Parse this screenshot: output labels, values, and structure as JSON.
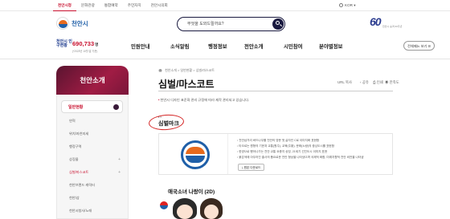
{
  "topbar": {
    "tabs": [
      "천안시청",
      "문화관광",
      "통합예약",
      "주민자치",
      "천안시의회"
    ],
    "active_tab_index": 0,
    "lang": "KOR"
  },
  "header": {
    "logo_text": "천안시",
    "search_placeholder": "무엇을 도와드릴까요?",
    "anniversary_number": "60",
    "anniversary_sub": "천안시 승격 60주년"
  },
  "population": {
    "label": "천안시 인구현황",
    "count": "690,733",
    "unit": "명",
    "date": "(*2023년 10월 말 기준)"
  },
  "gnb": {
    "items": [
      "민원안내",
      "소식알림",
      "행정정보",
      "천안소개",
      "시민참여",
      "분야별정보"
    ],
    "all_menu": "전체메뉴 보기"
  },
  "sidebar": {
    "title": "천안소개",
    "submenu": "일반현황",
    "items": [
      {
        "label": "연혁",
        "active": false
      },
      {
        "label": "위치/자연지세",
        "active": false
      },
      {
        "label": "행정구역",
        "active": false
      },
      {
        "label": "상징물",
        "active": false
      },
      {
        "label": "심벌/마스코트",
        "active": true
      },
      {
        "label": "천안브랜드 캐릭터",
        "active": false
      },
      {
        "label": "천안/삼",
        "active": false
      },
      {
        "label": "천안시청사/노래",
        "active": false
      }
    ]
  },
  "breadcrumb": [
    "천안소개",
    "일반현황",
    "심벌/마스코트"
  ],
  "page": {
    "title": "심벌/마스코트",
    "tools": [
      "URL 복사",
      "공유",
      "인쇄",
      "만족도"
    ],
    "intro": "천안시 디자인 표준화 관리 규정에 따라 제작 관리되고 있습니다.",
    "section1_dots": "••",
    "section1_title": "심벌마크",
    "desc": [
      "천안삼거리 버드나무를 천안의 영문 첫 글자인 C로 이미지화 표현함",
      "타오르는 원형의 기운과 교통(원주), 교육(주황), 문화(노랑)의 중심도시를 표현함",
      "한양으로 뻗어나가는 천안 교통 요충지 상징, 21세기 선진도시 이미지 표현",
      "붉은색에 아우러진 출사의 풍요로운 천안 형상을 나타냈으며 국제적 화합, 미래지향적 천안 비전을 나타냄"
    ],
    "download_label": "원본 다운로드",
    "section2_title": "애국소녀 나랑이 (2D)"
  },
  "colors": {
    "accent": "#c8102e",
    "navy": "#1a1a40",
    "sidebar_gradient": "#a01c44",
    "symbol_orange": "#e86a1c",
    "symbol_blue": "#1f5fa8"
  }
}
